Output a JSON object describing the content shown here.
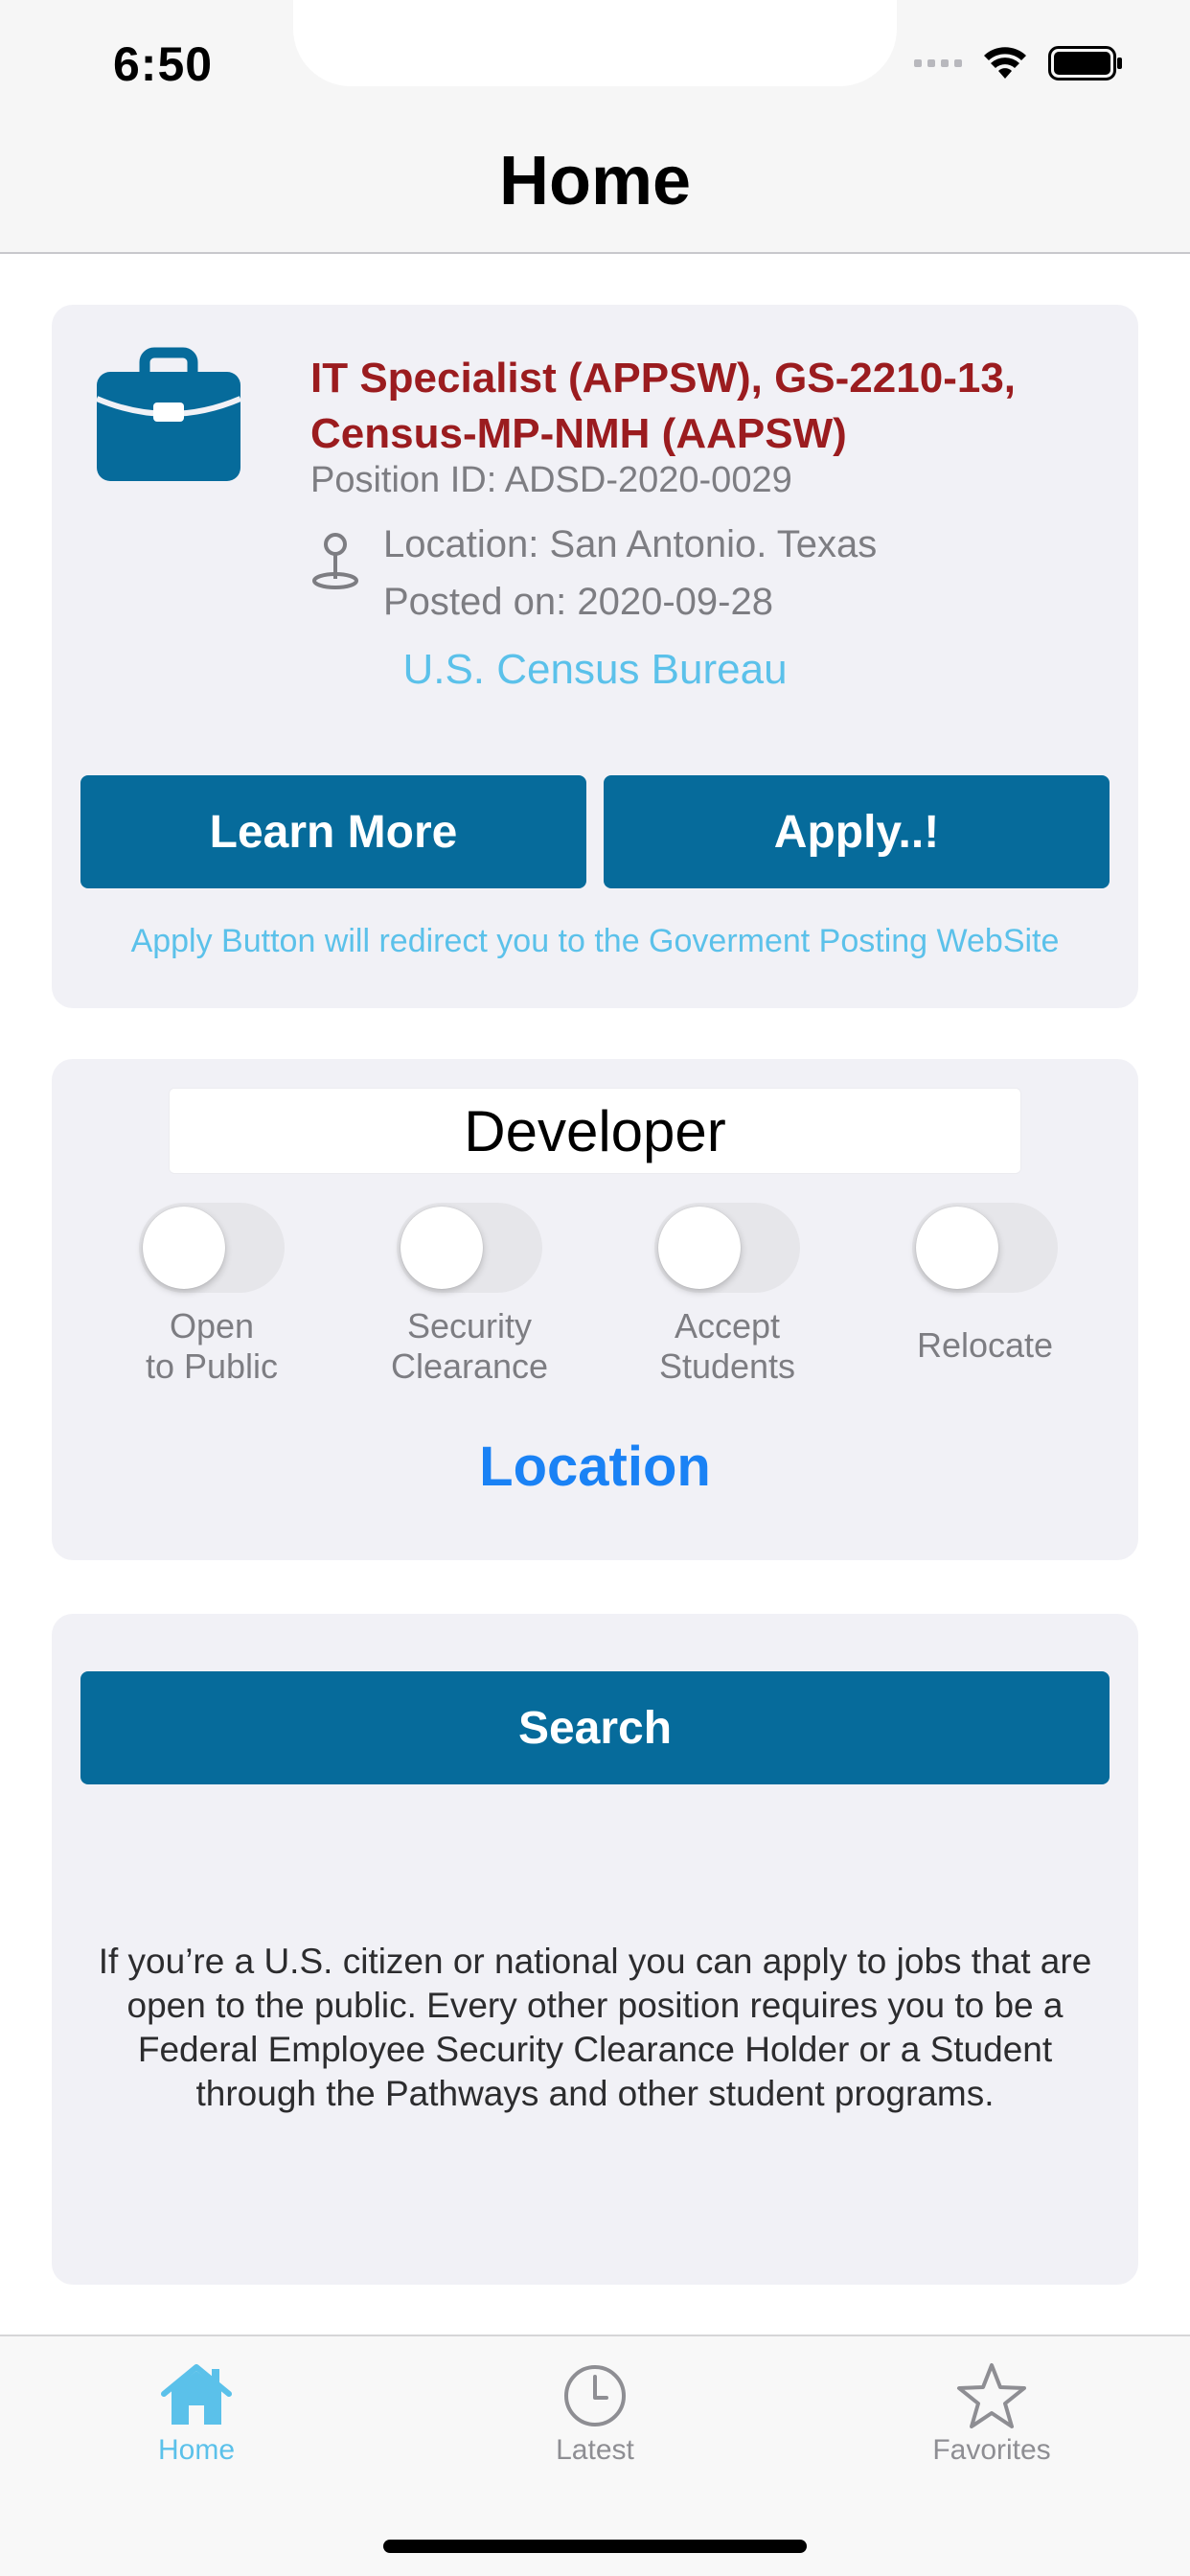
{
  "status_bar": {
    "time": "6:50"
  },
  "header": {
    "title": "Home"
  },
  "job_card": {
    "title": "IT Specialist (APPSW), GS-2210-13, Census-MP-NMH (AAPSW)",
    "position_id": "Position ID: ADSD-2020-0029",
    "location": "Location: San Antonio. Texas",
    "posted": "Posted on: 2020-09-28",
    "agency": "U.S. Census Bureau",
    "learn_more_label": "Learn More",
    "apply_label": "Apply..!",
    "redirect_note": "Apply Button will redirect you to the Goverment Posting WebSite",
    "icon": "briefcase-icon"
  },
  "filters": {
    "keyword_value": "Developer",
    "toggles": [
      {
        "label": "Open\nto Public",
        "on": false
      },
      {
        "label": "Security\nClearance",
        "on": false
      },
      {
        "label": "Accept\nStudents",
        "on": false
      },
      {
        "label": "Relocate",
        "on": false
      }
    ],
    "location_label": "Location"
  },
  "search": {
    "button_label": "Search",
    "info": "If you’re a U.S. citizen or national you can apply to jobs that are open to the public. Every other position requires you to be a Federal Employee Security Clearance Holder or a Student through the Pathways and other student programs."
  },
  "tab_bar": {
    "tabs": [
      {
        "label": "Home",
        "icon": "home-icon",
        "active": true
      },
      {
        "label": "Latest",
        "icon": "clock-icon",
        "active": false
      },
      {
        "label": "Favorites",
        "icon": "star-icon",
        "active": false
      }
    ]
  },
  "colors": {
    "primary_button": "#066b9b",
    "job_title": "#9b1c1f",
    "link_light": "#5bc1ea",
    "link_blue": "#1a82f5",
    "card_bg": "#f1f1f6"
  }
}
